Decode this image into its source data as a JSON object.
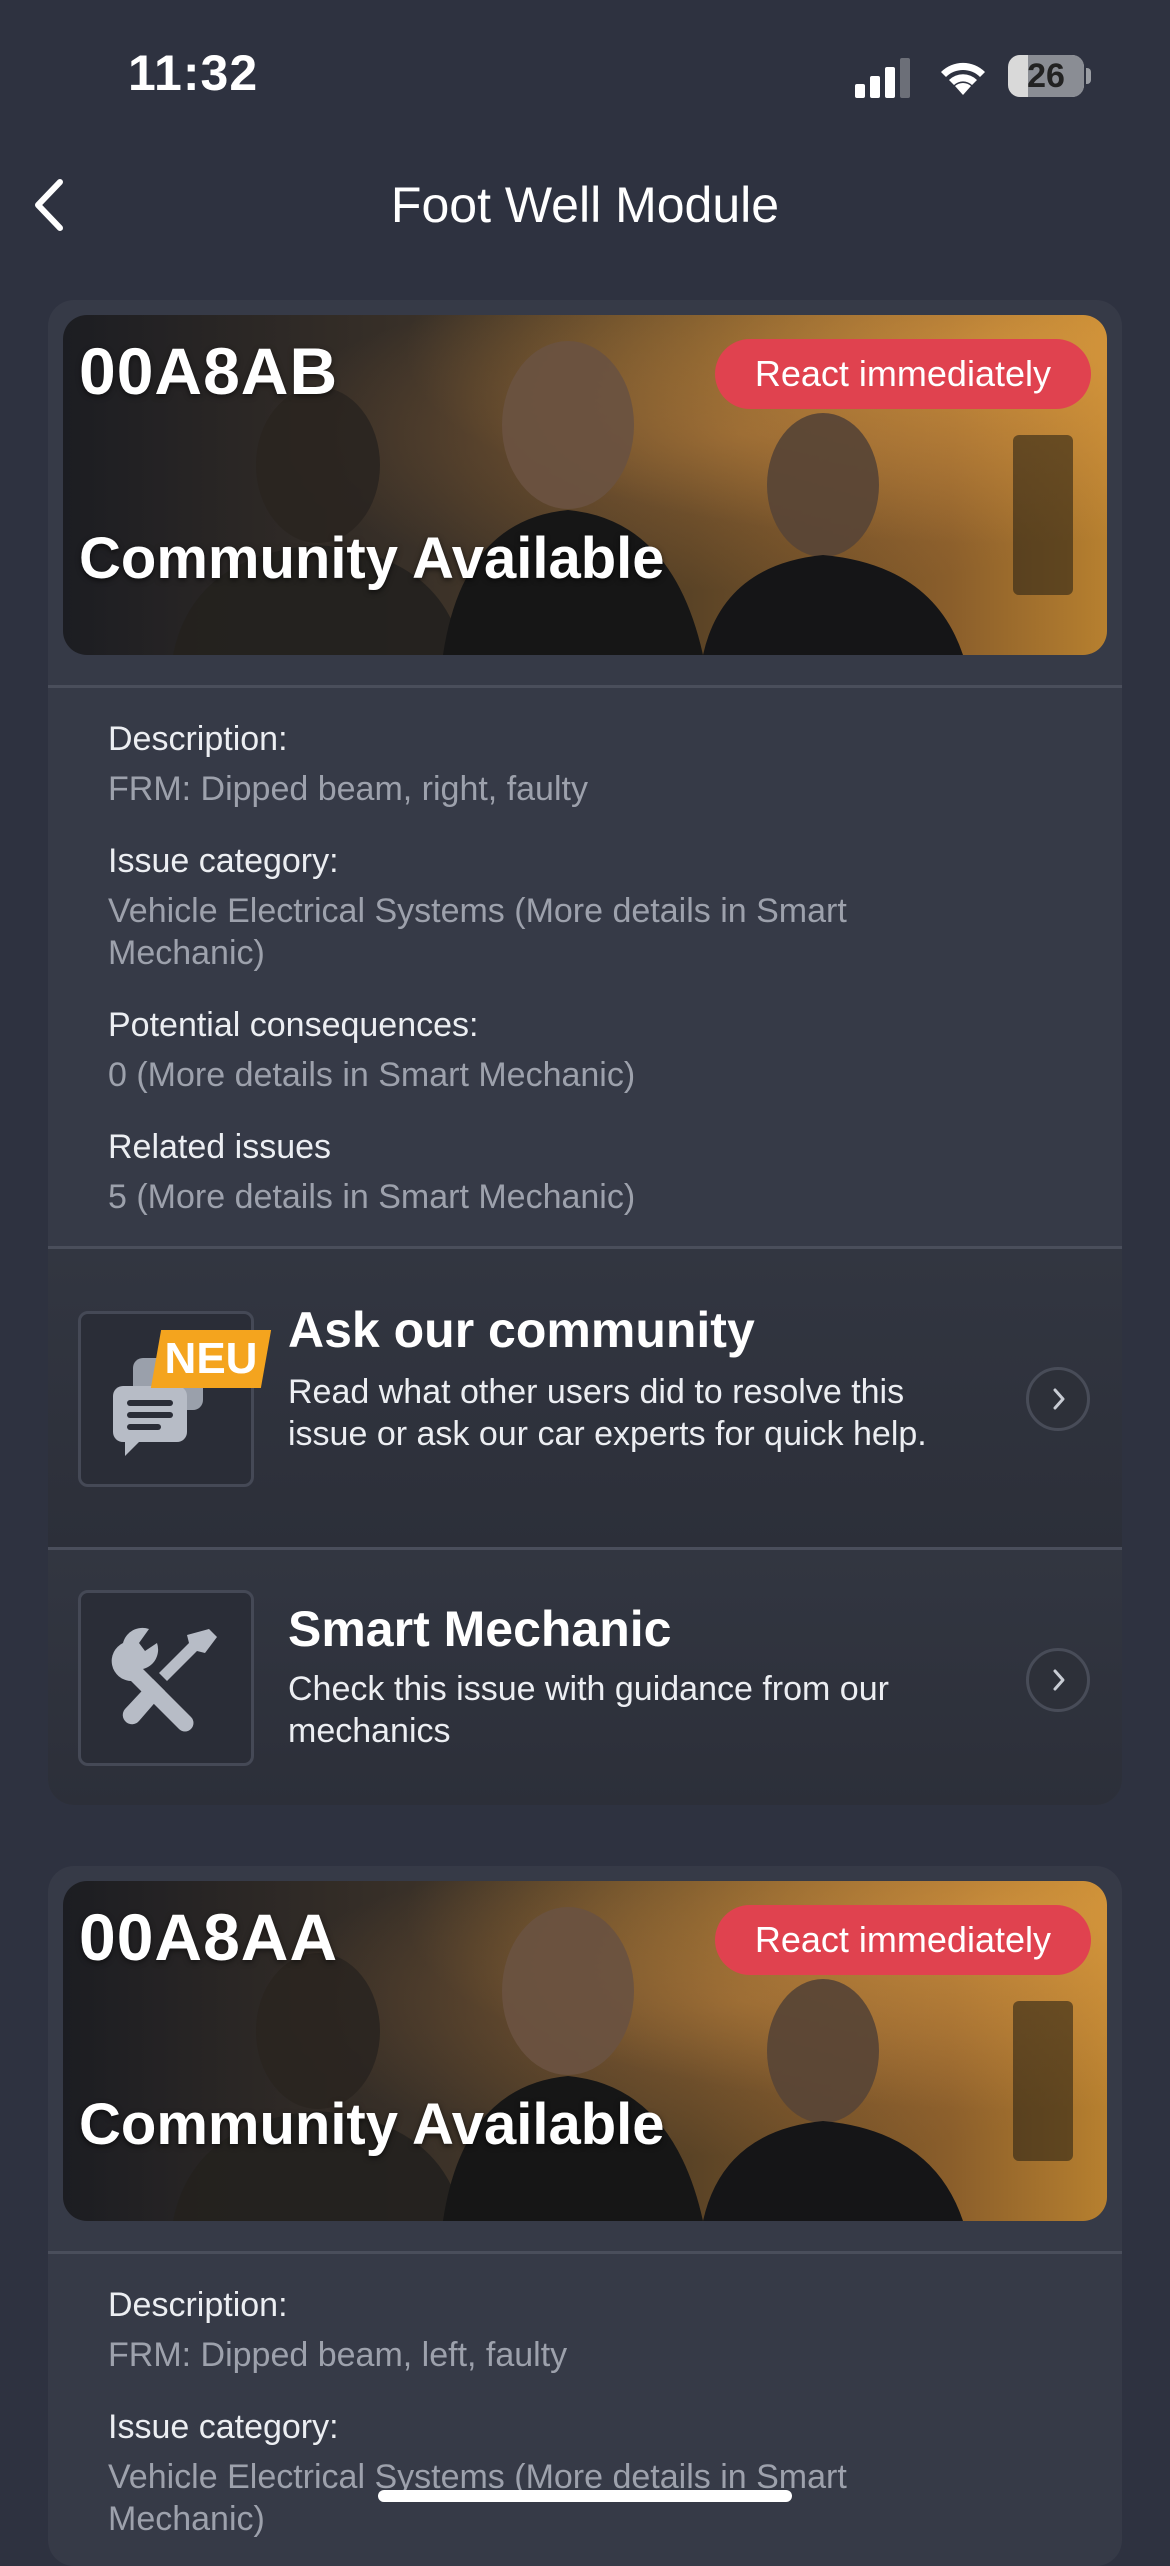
{
  "status_bar": {
    "time": "11:32",
    "battery": "26",
    "battery_level_percent": 26,
    "icons": [
      "signal-icon",
      "wifi-icon",
      "battery-icon"
    ]
  },
  "nav": {
    "title": "Foot Well Module",
    "back_icon": "chevron-left-icon"
  },
  "cards": [
    {
      "code": "00A8AB",
      "badge": "React immediately",
      "community": "Community Available",
      "description_label": "Description:",
      "description_value": "FRM: Dipped beam, right, faulty",
      "category_label": "Issue category:",
      "category_value": "Vehicle Electrical Systems (More details in Smart Mechanic)",
      "consequences_label": "Potential consequences:",
      "consequences_value": "0 (More details in Smart Mechanic)",
      "related_label": "Related issues",
      "related_value": "5 (More details in Smart Mechanic)",
      "community_action": {
        "badge": "NEU",
        "title": "Ask our community",
        "description": "Read what other users did to resolve this issue or ask our car experts for quick help.",
        "icon": "chat-bubbles-icon"
      },
      "mechanic_action": {
        "title": "Smart Mechanic",
        "description": "Check this issue with guidance from our mechanics",
        "icon": "wrench-screwdriver-icon"
      }
    },
    {
      "code": "00A8AA",
      "badge": "React immediately",
      "community": "Community Available",
      "description_label": "Description:",
      "description_value": "FRM: Dipped beam, left, faulty",
      "category_label": "Issue category:",
      "category_value": "Vehicle Electrical Systems (More details in Smart Mechanic)"
    }
  ],
  "colors": {
    "background": "#2e3240",
    "card": "#363a47",
    "badge_red": "#e0424f",
    "neu_orange": "#f4a41e",
    "muted_text": "#9da1ac"
  }
}
